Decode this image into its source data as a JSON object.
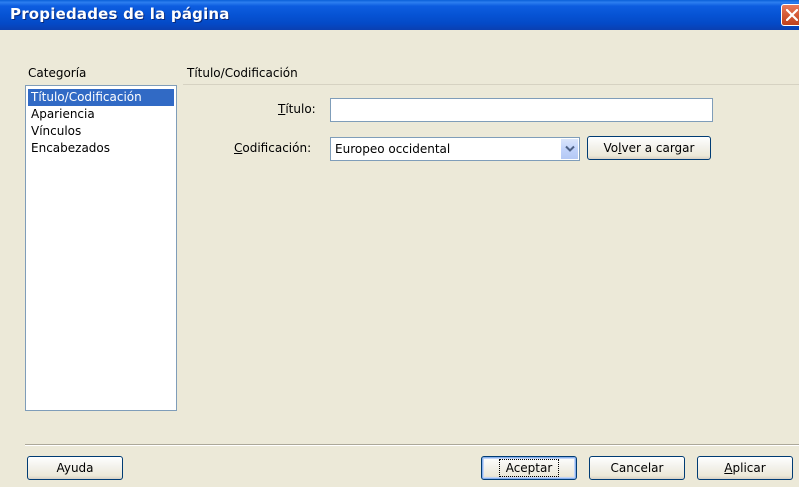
{
  "window": {
    "title": "Propiedades de la página"
  },
  "category": {
    "label": "Categoría",
    "items": [
      {
        "label": "Título/Codificación",
        "selected": true
      },
      {
        "label": "Apariencia",
        "selected": false
      },
      {
        "label": "Vínculos",
        "selected": false
      },
      {
        "label": "Encabezados",
        "selected": false
      }
    ]
  },
  "section": {
    "title": "Título/Codificación",
    "title_field": {
      "label_underlined": "T",
      "label_rest": "ítulo:",
      "value": "",
      "placeholder": ""
    },
    "encoding_field": {
      "label_underlined": "C",
      "label_rest": "odificación:",
      "selected": "Europeo occidental"
    },
    "reload_button": {
      "label_pre": "Vo",
      "label_underlined": "l",
      "label_post": "ver a cargar"
    }
  },
  "footer": {
    "help_label": "Ayuda",
    "accept_label": "Aceptar",
    "cancel_label": "Cancelar",
    "apply_underlined": "A",
    "apply_rest": "plicar"
  },
  "colors": {
    "selection": "#316ac5",
    "title_bar": "#0653d4",
    "close_button": "#d45a36"
  }
}
